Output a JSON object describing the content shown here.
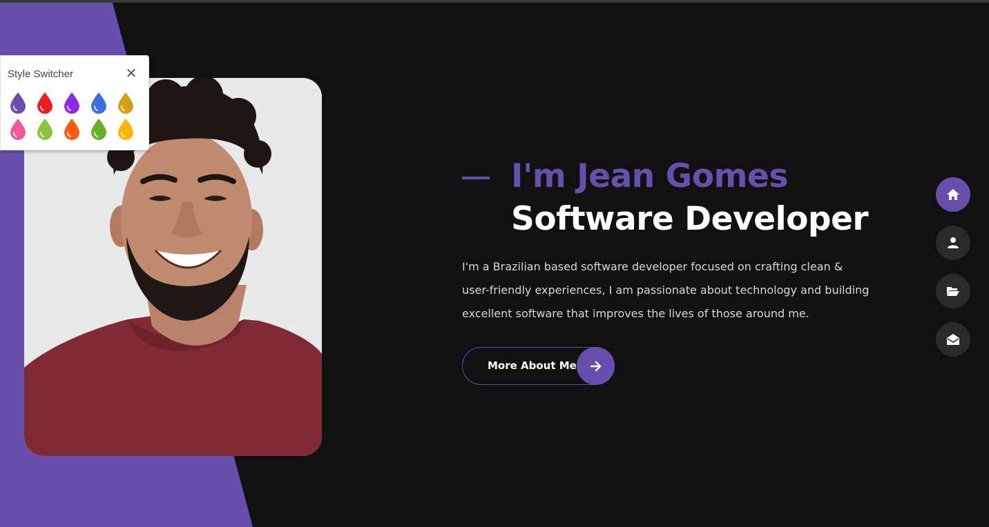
{
  "colors": {
    "background": "#111111",
    "accent": "#6750ad",
    "text": "#ffffff",
    "muted_text": "#d8d8d8",
    "nav_inactive": "#2a2a2a"
  },
  "style_switcher": {
    "title": "Style Switcher",
    "close_icon": "close-icon",
    "swatches": [
      {
        "name": "purple",
        "color": "#6750ad"
      },
      {
        "name": "red",
        "color": "#ec1c24"
      },
      {
        "name": "violet",
        "color": "#8a2be2"
      },
      {
        "name": "blue",
        "color": "#3e6fe0"
      },
      {
        "name": "gold",
        "color": "#d4a017"
      },
      {
        "name": "pink",
        "color": "#f0589a"
      },
      {
        "name": "lime",
        "color": "#8cc63f"
      },
      {
        "name": "orange",
        "color": "#fa5b0f"
      },
      {
        "name": "green",
        "color": "#6ab024"
      },
      {
        "name": "yellow",
        "color": "#ffb400"
      }
    ]
  },
  "hero": {
    "name": "I'm Jean Gomes",
    "role": "Software Developer",
    "bio_lines": [
      "I'm a Brazilian based software developer focused on crafting clean &",
      "user-friendly experiences, I am passionate about technology and building",
      "excellent software that improves the lives of those around me."
    ],
    "cta_label": "More About Me",
    "cta_icon": "arrow-right-icon"
  },
  "side_nav": [
    {
      "id": "home",
      "icon": "home-icon",
      "active": true
    },
    {
      "id": "about",
      "icon": "user-icon",
      "active": false
    },
    {
      "id": "portfolio",
      "icon": "folder-open-icon",
      "active": false
    },
    {
      "id": "contact",
      "icon": "envelope-open-icon",
      "active": false
    }
  ]
}
